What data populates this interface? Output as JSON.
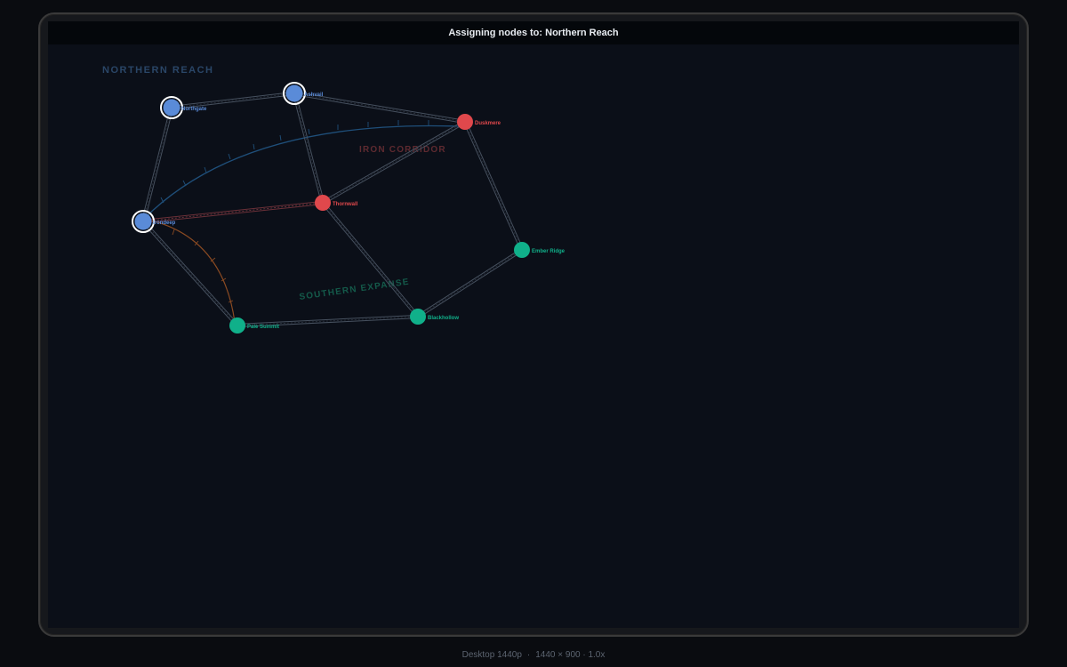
{
  "status": {
    "prefix": "Assigning nodes to:",
    "region": "Northern Reach"
  },
  "regions": [
    {
      "id": "northern-reach",
      "label": "NORTHERN REACH",
      "color": "#2a4667"
    },
    {
      "id": "iron-corridor",
      "label": "IRON CORRIDOR",
      "color": "#5e2a30"
    },
    {
      "id": "southern-expanse",
      "label": "SOUTHERN EXPANSE",
      "color": "#145a4a"
    }
  ],
  "node_colors": {
    "northern": "#5a8bd8",
    "iron": "#e0484c",
    "southern": "#10b08a"
  },
  "nodes": [
    {
      "id": "northgate",
      "label": "Northgate",
      "region": "northern",
      "selected": true
    },
    {
      "id": "ashvail",
      "label": "Ashvail",
      "region": "northern",
      "selected": true
    },
    {
      "id": "irondeep",
      "label": "Irondeep",
      "region": "northern",
      "selected": true
    },
    {
      "id": "duskmere",
      "label": "Duskmere",
      "region": "iron",
      "selected": false
    },
    {
      "id": "thornwall",
      "label": "Thornwall",
      "region": "iron",
      "selected": false
    },
    {
      "id": "ember-ridge",
      "label": "Ember Ridge",
      "region": "southern",
      "selected": false
    },
    {
      "id": "blackhollow",
      "label": "Blackhollow",
      "region": "southern",
      "selected": false
    },
    {
      "id": "pale-summit",
      "label": "Pale Summit",
      "region": "southern",
      "selected": false
    }
  ],
  "edges": [
    [
      "northgate",
      "ashvail"
    ],
    [
      "ashvail",
      "duskmere"
    ],
    [
      "northgate",
      "irondeep"
    ],
    [
      "ashvail",
      "thornwall"
    ],
    [
      "duskmere",
      "thornwall"
    ],
    [
      "duskmere",
      "ember-ridge"
    ],
    [
      "irondeep",
      "thornwall"
    ],
    [
      "irondeep",
      "pale-summit"
    ],
    [
      "thornwall",
      "blackhollow"
    ],
    [
      "pale-summit",
      "blackhollow"
    ],
    [
      "blackhollow",
      "ember-ridge"
    ]
  ],
  "footer": {
    "device": "Desktop 1440p",
    "resolution": "1440 × 900 · 1.0x"
  }
}
